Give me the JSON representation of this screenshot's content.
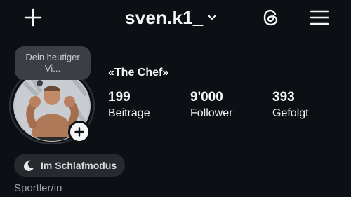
{
  "header": {
    "username": "sven.k1_",
    "icons": [
      "plus-icon",
      "chevron-down-icon",
      "threads-icon",
      "hamburger-menu-icon"
    ]
  },
  "note": {
    "text": "Dein heutiger Vi..."
  },
  "profile": {
    "display_name": "«The Chef»"
  },
  "stats": [
    {
      "value": "199",
      "label": "Beiträge"
    },
    {
      "value": "9'000",
      "label": "Follower"
    },
    {
      "value": "393",
      "label": "Gefolgt"
    }
  ],
  "status": {
    "label": "Im Schlafmodus",
    "icon": "moon-icon"
  },
  "category": "Sportler/in",
  "colors": {
    "background": "#0c1014",
    "text": "#f5f5f5",
    "chip": "#262a2f",
    "muted": "#9aa0a6"
  }
}
